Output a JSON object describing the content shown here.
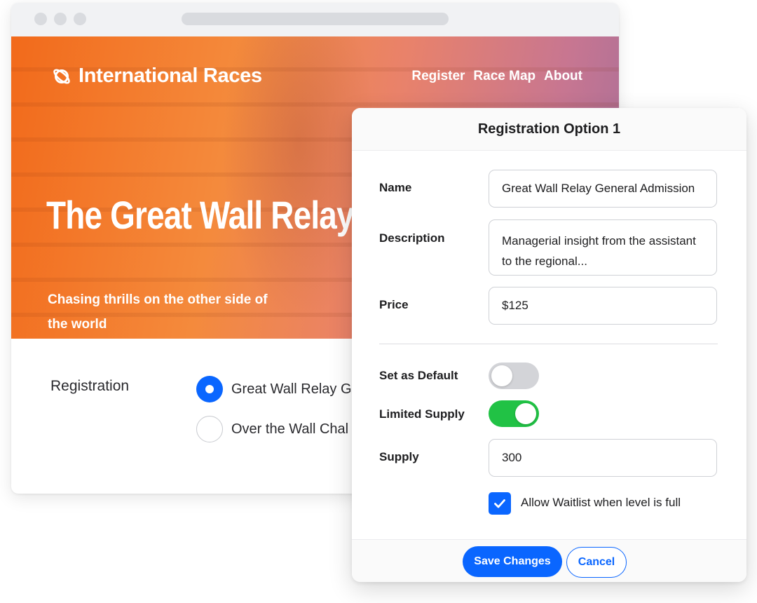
{
  "site": {
    "brand": "International Races",
    "nav": [
      "Register",
      "Race Map",
      "About"
    ]
  },
  "hero": {
    "title": "The Great Wall Relay",
    "subtitle": "Chasing thrills on the other side of the world"
  },
  "registration": {
    "label": "Registration",
    "options": [
      {
        "label": "Great Wall Relay G",
        "selected": true
      },
      {
        "label": "Over the Wall Chal",
        "selected": false
      }
    ]
  },
  "modal": {
    "title": "Registration Option 1",
    "fields": {
      "name_label": "Name",
      "name_value": "Great Wall Relay General Admission",
      "description_label": "Description",
      "description_value": "Managerial insight from the assistant to the regional...",
      "price_label": "Price",
      "price_value": "$125",
      "default_label": "Set as Default",
      "default_on": false,
      "limited_label": "Limited Supply",
      "limited_on": true,
      "supply_label": "Supply",
      "supply_value": "300",
      "waitlist_label": "Allow Waitlist when level is full",
      "waitlist_checked": true
    },
    "save_label": "Save Changes",
    "cancel_label": "Cancel"
  },
  "colors": {
    "accent": "#0a66ff",
    "toggle_on": "#21c245",
    "toggle_off": "#d3d4d8",
    "hero_start": "#f26a1b",
    "hero_end": "#a86f99"
  }
}
